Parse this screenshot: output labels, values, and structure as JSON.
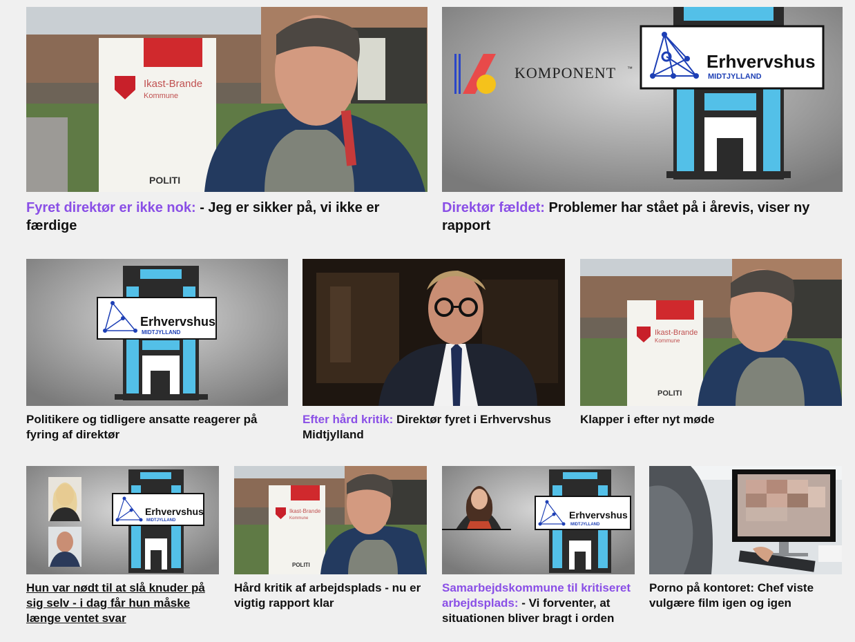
{
  "accent_color": "#8a4fe6",
  "articles": [
    {
      "kicker": "Fyret direktør er ikke nok:",
      "title": " - Jeg er sikker på, vi ikke er færdige",
      "image": "man-at-ikast-brande-sign",
      "sign_text": "Ikast-Brande",
      "sign_sub": "Kommune",
      "sign_police": "POLITI"
    },
    {
      "kicker": "Direktør fældet:",
      "title": " Problemer har stået på i årevis, viser ny rapport",
      "image": "komponent-erhvervshus-logo",
      "logo_komponent": "KOMPONENT",
      "logo_tm": "™",
      "logo_name": "Erhvervshus",
      "logo_sub": "MIDTJYLLAND"
    },
    {
      "kicker": "",
      "title": "Politikere og tidligere ansatte reagerer på fyring af direktør",
      "image": "erhvervshus-building-logo",
      "logo_name": "Erhvervshus",
      "logo_sub": "MIDTJYLLAND"
    },
    {
      "kicker": "Efter hård kritik:",
      "title": " Direktør fyret i Erhvervshus Midtjylland",
      "image": "man-with-glasses-portrait"
    },
    {
      "kicker": "",
      "title": "Klapper i efter nyt møde",
      "image": "man-at-ikast-brande-sign",
      "sign_text": "Ikast-Brande",
      "sign_sub": "Kommune",
      "sign_police": "POLITI"
    },
    {
      "kicker": "",
      "title": "Hun var nødt til at slå knuder på sig selv - i dag får hun måske længe ventet svar",
      "image": "two-portraits-erhvervshus",
      "logo_name": "Erhvervshus",
      "logo_sub": "MIDTJYLLAND"
    },
    {
      "kicker": "",
      "title": "Hård kritik af arbejdsplads - nu er vigtig rapport klar",
      "image": "man-at-ikast-brande-sign",
      "sign_text": "Ikast-Brande",
      "sign_sub": "Kommune",
      "sign_police": "POLITI"
    },
    {
      "kicker": "Samarbejdskommune til kritiseret arbejdsplads:",
      "title": " - Vi forventer, at situationen bliver bragt i orden",
      "image": "woman-portrait-erhvervshus",
      "logo_name": "Erhvervshus",
      "logo_sub": "MIDTJYLLAND"
    },
    {
      "kicker": "",
      "title": "Porno på kontoret: Chef viste vulgære film igen og igen",
      "image": "person-at-computer-pixelated"
    }
  ]
}
